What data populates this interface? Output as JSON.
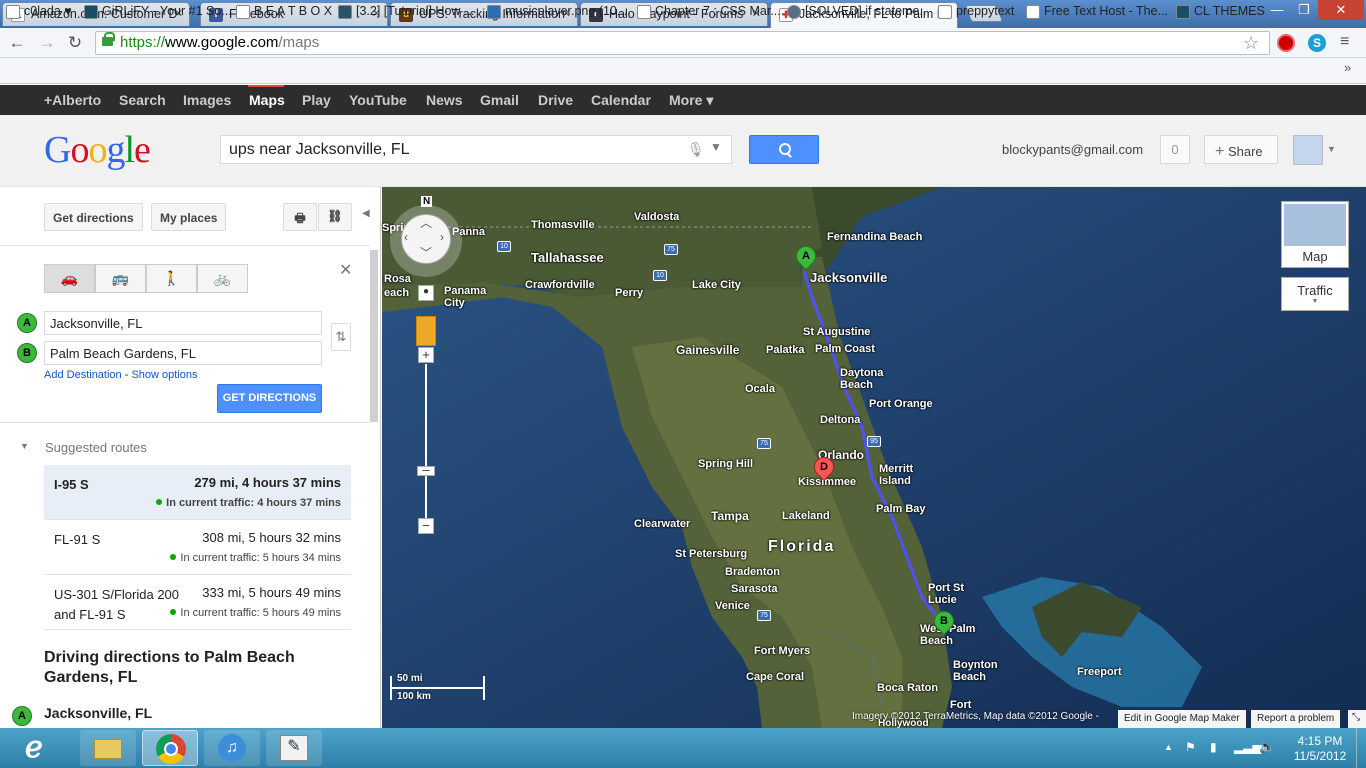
{
  "browser": {
    "tabs": [
      {
        "title": "Amazon.com: Customer D",
        "icon": "amazon-icon",
        "color": "#f90"
      },
      {
        "title": "Facebook",
        "icon": "facebook-icon",
        "color": "#3b5998"
      },
      {
        "title": "UPS: Tracking Information",
        "icon": "ups-icon",
        "color": "#5b3a1b"
      },
      {
        "title": "Halo Waypoint - Forums",
        "icon": "halo-icon",
        "color": "#334"
      },
      {
        "title": "Jacksonville, FL to Palm Be",
        "icon": "maps-icon",
        "color": "#d33"
      }
    ],
    "url_https": "https://",
    "url_host": "www.google.com",
    "url_path": "/maps",
    "bookmarks": [
      "c0lada ♥",
      "GiRLiFY - Your #1 So...",
      "B E A T B O X",
      "[3.2] [Tutorial] How ...",
      "musicplayer.png (10...",
      "Chapter 7 : CSS Mar...",
      "[SOLVED] if stateme...",
      "preppytext",
      "Free Text Host - The...",
      "CL THEMES"
    ]
  },
  "gbar": {
    "links": [
      "+Alberto",
      "Search",
      "Images",
      "Maps",
      "Play",
      "YouTube",
      "News",
      "Gmail",
      "Drive",
      "Calendar",
      "More ▾"
    ],
    "selected": "Maps"
  },
  "header": {
    "logo": "Google",
    "search_value": "ups near Jacksonville, FL",
    "user_email": "blockypants@gmail.com",
    "notification_count": "0",
    "share_label": "Share"
  },
  "panel": {
    "get_directions_label": "Get directions",
    "my_places_label": "My places",
    "origin_marker": "A",
    "origin": "Jacksonville, FL",
    "destination_marker": "B",
    "destination": "Palm Beach Gardens, FL",
    "add_destination": "Add Destination",
    "show_options": "Show options",
    "get_directions_button": "GET DIRECTIONS",
    "suggested_routes_label": "Suggested routes",
    "routes": [
      {
        "name": "I-95 S",
        "time": "279 mi, 4 hours 37 mins",
        "traffic": "In current traffic: 4 hours 37 mins",
        "selected": true
      },
      {
        "name": "FL-91 S",
        "time": "308 mi, 5 hours 32 mins",
        "traffic": "In current traffic: 5 hours 34 mins",
        "selected": false
      },
      {
        "name": "US-301 S/Florida 200 and FL-91 S",
        "time": "333 mi, 5 hours 49 mins",
        "traffic": "In current traffic: 5 hours 49 mins",
        "selected": false
      }
    ],
    "driving_title": "Driving directions to Palm Beach Gardens, FL",
    "first_step_marker": "A",
    "first_step": "Jacksonville, FL"
  },
  "map": {
    "cities": [
      "Thomasville",
      "Valdosta",
      "Tallahassee",
      "Fernandina Beach",
      "Jacksonville",
      "Crawfordville",
      "Perry",
      "Lake City",
      "Panama City",
      "Rosa",
      "each",
      "Panna",
      "Sprin",
      "Gainesville",
      "Palatka",
      "St Augustine",
      "Palm Coast",
      "Ocala",
      "Daytona Beach",
      "Port Orange",
      "Deltona",
      "Orlando",
      "Kissimmee",
      "Spring Hill",
      "Merritt Island",
      "Palm Bay",
      "Clearwater",
      "Tampa",
      "Lakeland",
      "St Petersburg",
      "Florida",
      "Bradenton",
      "Sarasota",
      "Venice",
      "Port St Lucie",
      "West Palm Beach",
      "Fort Myers",
      "Cape Coral",
      "Boynton Beach",
      "Boca Raton",
      "Freeport",
      "Fort",
      "Hollywood"
    ],
    "highway_shields": [
      "10",
      "75",
      "10",
      "75",
      "95",
      "75"
    ],
    "marker_a": "A",
    "marker_b": "B",
    "marker_d": "D",
    "compass": "N",
    "map_type_label": "Map",
    "traffic_label": "Traffic",
    "scale_mi": "50 mi",
    "scale_km": "100 km",
    "attribution": "Imagery ©2012 TerraMetrics, Map data ©2012 Google -",
    "edit_link": "Edit in Google Map Maker",
    "report_link": "Report a problem"
  },
  "taskbar": {
    "time": "4:15 PM",
    "date": "11/5/2012"
  }
}
